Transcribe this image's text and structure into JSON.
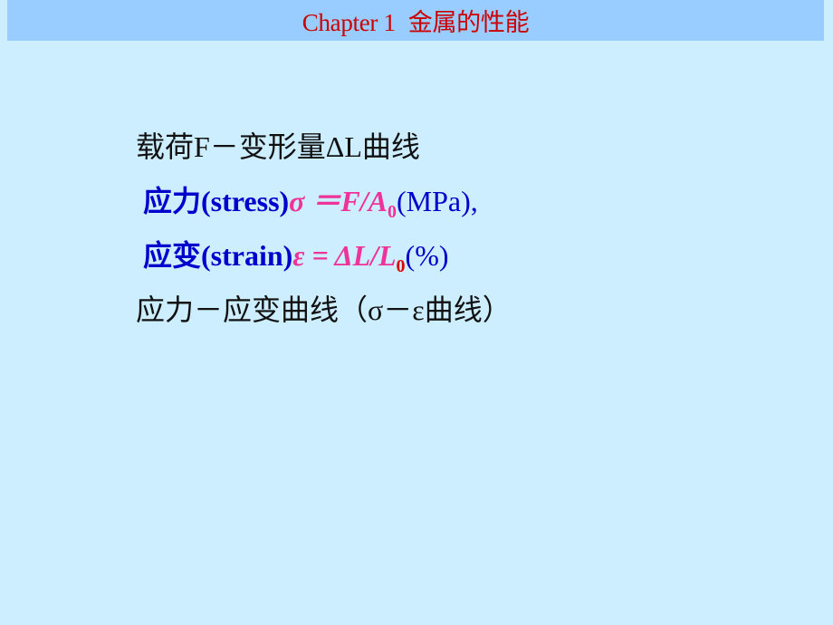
{
  "header": {
    "chapter": "Chapter 1",
    "title": "金属的性能"
  },
  "slide": {
    "line1": "载荷F－变形量ΔL曲线",
    "stress": {
      "term_cn": "应力",
      "term_en": "(stress)",
      "formula_lhs": "σ ＝F/A",
      "subscript": "0",
      "unit": "(MPa),"
    },
    "strain": {
      "term_cn": "应变",
      "term_en": "(strain)",
      "formula_lhs": "ε = ΔL/L",
      "subscript": "0",
      "unit": "(%)"
    },
    "line4": "应力－应变曲线（σ－ε曲线）"
  },
  "colors": {
    "background": "#cceeff",
    "header_bar": "#99ccff",
    "header_text": "#cc0000",
    "term_blue": "#0000cc",
    "formula_pink": "#ee3399",
    "subscript_red": "#dd0000"
  }
}
